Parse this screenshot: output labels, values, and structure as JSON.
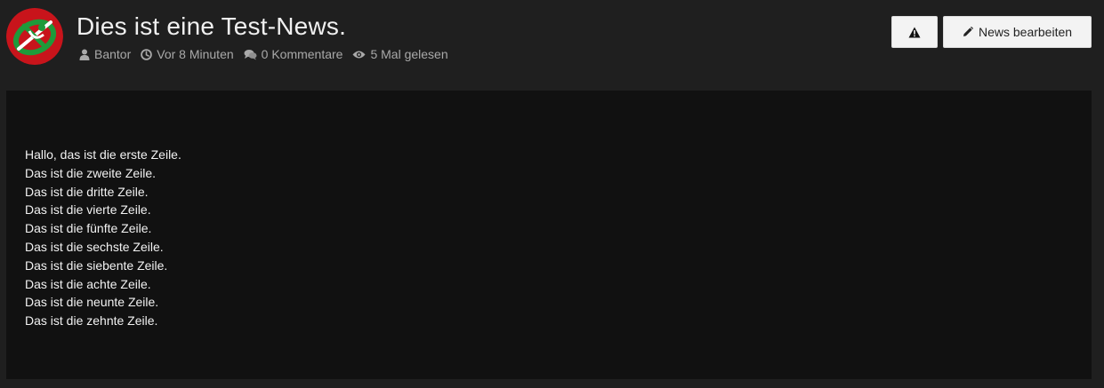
{
  "header": {
    "title": "Dies ist eine Test-News.",
    "author": "Bantor",
    "time": "Vor 8 Minuten",
    "comments": "0 Kommentare",
    "views": "5 Mal gelesen",
    "edit_button_label": "News bearbeiten"
  },
  "icons": {
    "avatar": "avatar-logo",
    "author": "user-icon",
    "time": "clock-icon",
    "comments": "comments-icon",
    "views": "eye-icon",
    "warn": "warning-icon",
    "edit": "pencil-icon"
  },
  "colors": {
    "page_background": "#1f1f1f",
    "content_background": "#111111",
    "button_background": "#f3f3f3",
    "avatar_red": "#c8141b",
    "avatar_green": "#1e9a3a"
  },
  "content": {
    "lines": [
      "Hallo, das ist die erste Zeile.",
      "Das ist die zweite Zeile.",
      "Das ist die dritte Zeile.",
      "Das ist die vierte Zeile.",
      "Das ist die fünfte Zeile.",
      "Das ist die sechste Zeile.",
      "Das ist die siebente Zeile.",
      "Das ist die achte Zeile.",
      "Das ist die neunte Zeile.",
      "Das ist die zehnte Zeile."
    ]
  }
}
